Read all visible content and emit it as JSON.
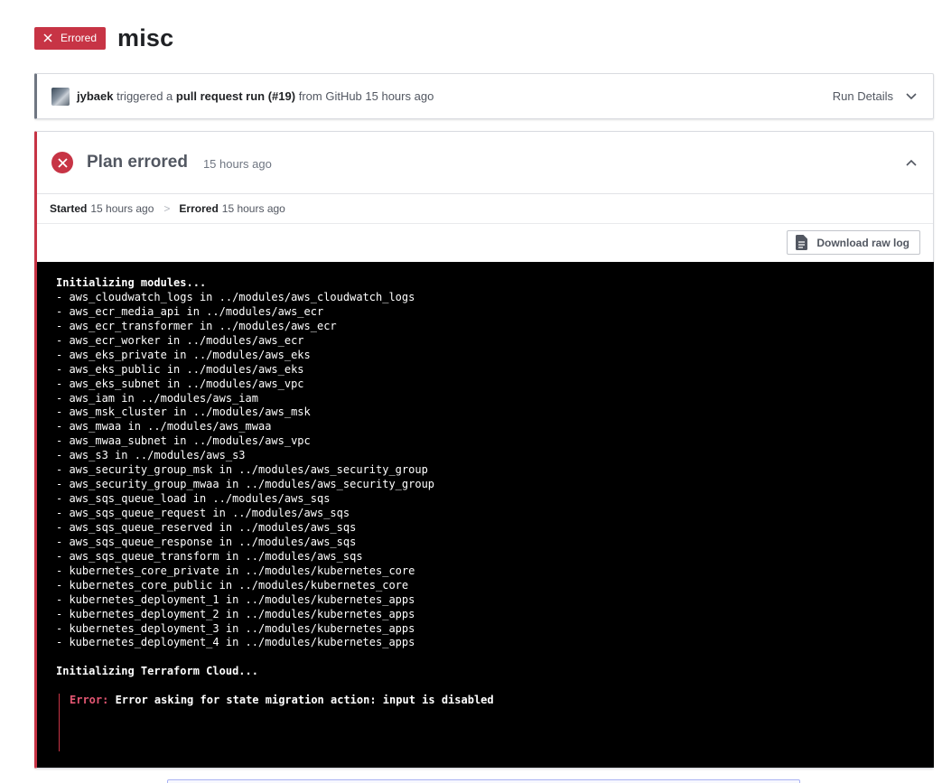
{
  "header": {
    "status": "Errored",
    "workspace": "misc"
  },
  "trigger": {
    "user": "jybaek",
    "verb": "triggered a",
    "run_type": "pull request run (#19)",
    "source": "from GitHub 15 hours ago",
    "run_details_label": "Run Details"
  },
  "plan": {
    "title": "Plan errored",
    "time": "15 hours ago",
    "timeline": {
      "started_label": "Started",
      "started_time": "15 hours ago",
      "errored_label": "Errored",
      "errored_time": "15 hours ago"
    },
    "download_label": "Download raw log"
  },
  "log": {
    "heading1": "Initializing modules...",
    "lines": [
      "- aws_cloudwatch_logs in ../modules/aws_cloudwatch_logs",
      "- aws_ecr_media_api in ../modules/aws_ecr",
      "- aws_ecr_transformer in ../modules/aws_ecr",
      "- aws_ecr_worker in ../modules/aws_ecr",
      "- aws_eks_private in ../modules/aws_eks",
      "- aws_eks_public in ../modules/aws_eks",
      "- aws_eks_subnet in ../modules/aws_vpc",
      "- aws_iam in ../modules/aws_iam",
      "- aws_msk_cluster in ../modules/aws_msk",
      "- aws_mwaa in ../modules/aws_mwaa",
      "- aws_mwaa_subnet in ../modules/aws_vpc",
      "- aws_s3 in ../modules/aws_s3",
      "- aws_security_group_msk in ../modules/aws_security_group",
      "- aws_security_group_mwaa in ../modules/aws_security_group",
      "- aws_sqs_queue_load in ../modules/aws_sqs",
      "- aws_sqs_queue_request in ../modules/aws_sqs",
      "- aws_sqs_queue_reserved in ../modules/aws_sqs",
      "- aws_sqs_queue_response in ../modules/aws_sqs",
      "- aws_sqs_queue_transform in ../modules/aws_sqs",
      "- kubernetes_core_private in ../modules/kubernetes_core",
      "- kubernetes_core_public in ../modules/kubernetes_core",
      "- kubernetes_deployment_1 in ../modules/kubernetes_apps",
      "- kubernetes_deployment_2 in ../modules/kubernetes_apps",
      "- kubernetes_deployment_3 in ../modules/kubernetes_apps",
      "- kubernetes_deployment_4 in ../modules/kubernetes_apps"
    ],
    "heading2": "Initializing Terraform Cloud...",
    "error_label": "Error:",
    "error_message": " Error asking for state migration action: input is disabled"
  }
}
